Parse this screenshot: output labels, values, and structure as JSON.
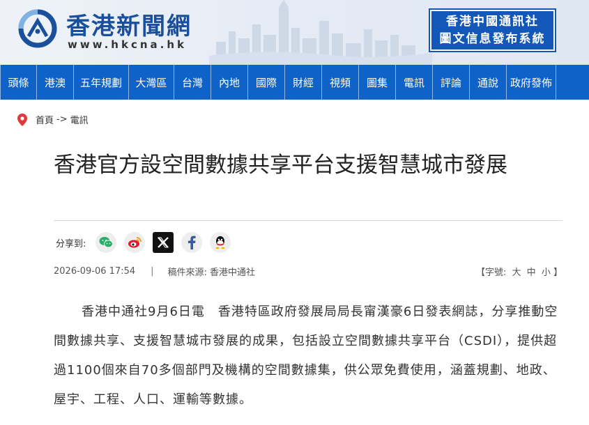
{
  "site": {
    "name": "香港新聞網",
    "url": "www.hkcna.hk",
    "agency_line1": "香港中國通訊社",
    "agency_line2": "圖文信息發布系統",
    "brand_color": "#0f62c8"
  },
  "nav": {
    "items": [
      {
        "label": "頭條"
      },
      {
        "label": "港澳"
      },
      {
        "label": "五年規劃"
      },
      {
        "label": "大灣區"
      },
      {
        "label": "台灣"
      },
      {
        "label": "內地"
      },
      {
        "label": "國際"
      },
      {
        "label": "財經"
      },
      {
        "label": "視頻"
      },
      {
        "label": "圖集"
      },
      {
        "label": "電訊"
      },
      {
        "label": "評論"
      },
      {
        "label": "通說"
      },
      {
        "label": "政府發佈"
      }
    ]
  },
  "breadcrumb": {
    "icon": "location-pin-icon",
    "home": "首頁",
    "separator": "->",
    "current": "電訊"
  },
  "article": {
    "title": "香港官方設空間數據共享平台支援智慧城市發展",
    "share_label": "分享到:",
    "share_icons": [
      "wechat-icon",
      "weibo-icon",
      "x-icon",
      "facebook-icon",
      "qq-icon"
    ],
    "date": "2026-09-06 17:54",
    "divider": "|",
    "source_label": "稿件來源:",
    "source": "香港中通社",
    "font_size_open": "【字號:",
    "font_large": "大",
    "font_medium": "中",
    "font_small": "小",
    "font_size_close": "】",
    "body": "香港中通社9月6日電　香港特區政府發展局局長甯漢豪6日發表網誌，分享推動空間數據共享、支援智慧城市發展的成果，包括設立空間數據共享平台（CSDI），提供超過1100個來自70多個部門及機構的空間數據集，供公眾免費使用，涵蓋規劃、地政、屋宇、工程、人口、運輸等數據。"
  }
}
